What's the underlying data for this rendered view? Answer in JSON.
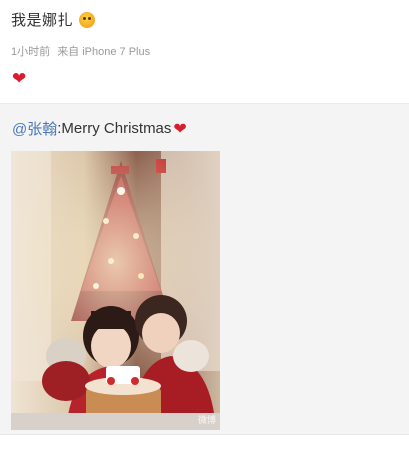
{
  "post": {
    "username": "我是娜扎",
    "time": "1小时前",
    "source": "来自 iPhone 7 Plus",
    "emoji_icon": "grinning-face-icon",
    "content_icon": "red-heart-icon"
  },
  "repost": {
    "mention": "@张翰",
    "text": ":Merry Christmas",
    "heart_icon": "red-heart-icon",
    "photo_description_icon": "christmas-photo",
    "watermark": "微博"
  },
  "colors": {
    "mention": "#4b78b6",
    "heart": "#d81e2c",
    "meta": "#9a9a9a",
    "repost_bg": "#f4f4f5"
  }
}
